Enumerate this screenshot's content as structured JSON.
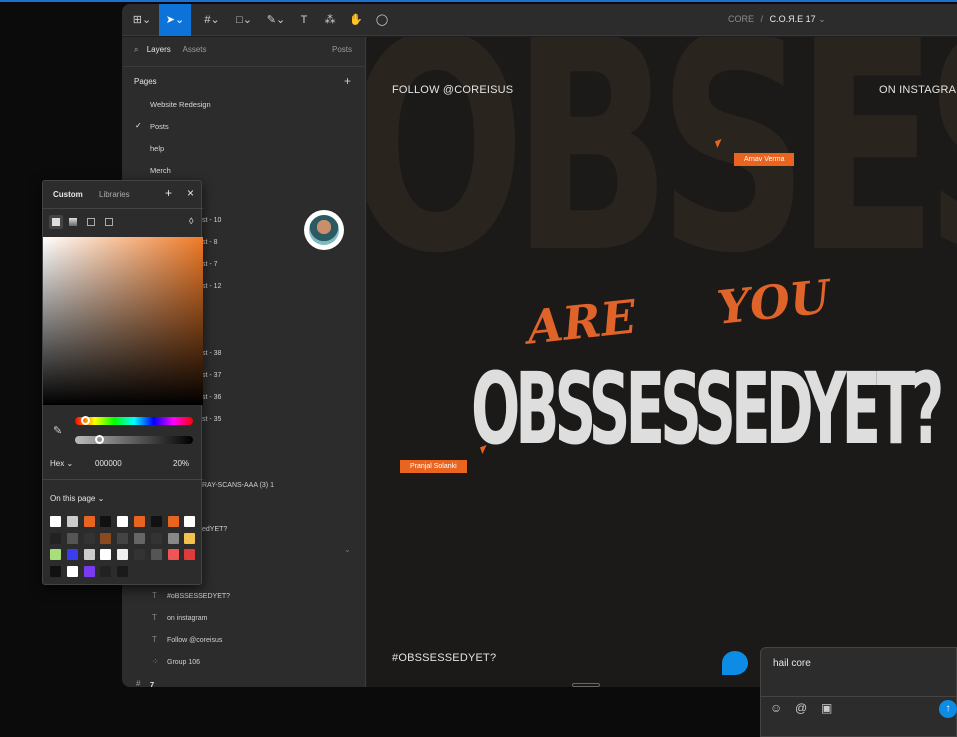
{
  "toolbar": {
    "breadcrumb_project": "CORE",
    "breadcrumb_sep": "/",
    "breadcrumb_file": "C.O.Я.E 17"
  },
  "left_panel": {
    "tabs": {
      "layers": "Layers",
      "assets": "Assets",
      "page_switch": "Posts"
    },
    "pages_header": "Pages",
    "pages": [
      "Website Redesign",
      "Posts",
      "help",
      "Merch"
    ],
    "layers_partial": [
      "st - 10",
      "st - 8",
      "st - 7",
      "st - 12",
      "st - 38",
      "st - 37",
      "st - 36",
      "st - 35",
      "RAY-SCANS-AAA (3) 1",
      "edYET?"
    ],
    "layers_bottom": [
      "#oBSSESSEDYET?",
      "on instagram",
      "Follow @coreisus",
      "Group 106"
    ],
    "frame_num": "7"
  },
  "canvas": {
    "follow": "FOLLOW @COREISUS",
    "on_insta": "ON INSTAGRA",
    "script_are": "ARE",
    "script_you": "YOU",
    "main": "OBSSESSEDYET?",
    "hashtag": "#OBSSESSEDYET?",
    "bg_text": "OBSESS"
  },
  "cursors": {
    "arnav": "Arnav Verma",
    "pranjal": "Pranjal Solanki"
  },
  "picker": {
    "tab_custom": "Custom",
    "tab_libraries": "Libraries",
    "plus": "+",
    "close": "×",
    "format": "Hex",
    "hex": "000000",
    "opacity": "20%",
    "on_page": "On this page",
    "swatches": [
      "#ffffff",
      "#cccccc",
      "#e8641f",
      "#111111",
      "#ffffff",
      "#e8641f",
      "#111111",
      "#e8641f",
      "#ffffff",
      "#222222",
      "#555555",
      "#333333",
      "#8a4a1d",
      "#444444",
      "#666666",
      "#333333",
      "#888888",
      "#f2c14e",
      "#a7e07a",
      "#3b3bf0",
      "#cccccc",
      "#ffffff",
      "#f0f0f0",
      "#333333",
      "#555555",
      "#f05555",
      "#e03a3a",
      "#111111",
      "#ffffff",
      "#7a3af0",
      "#222222",
      "#1a1a1a"
    ]
  },
  "comment": {
    "text": "hail core"
  }
}
